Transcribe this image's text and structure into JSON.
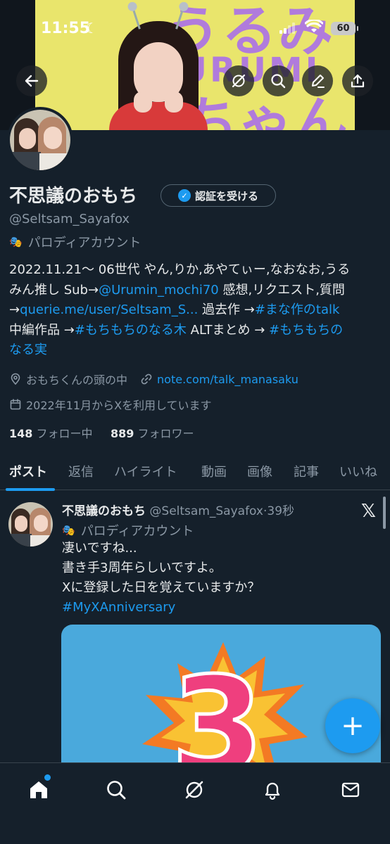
{
  "status_bar": {
    "time": "11:55",
    "battery": "60"
  },
  "banner": {
    "line1": "うるみ",
    "line2": "URUMI",
    "line3": "ちゃん"
  },
  "profile": {
    "display_name": "不思議のおもち",
    "verify_button": "認証を受ける",
    "handle": "@Seltsam_Sayafox",
    "parody_label": "パロディアカウント",
    "bio": {
      "l1": "2022.11.21～ 06世代 やん,りか,あやてぃー,なおなお,うる",
      "l2_a": "みん推し Sub→",
      "l2_link": "@Urumin_mochi70",
      "l2_b": " 感想,リクエスト,質問",
      "l3_a": "→",
      "l3_link": "querie.me/user/Seltsam_S...",
      "l3_b": " 過去作 →",
      "l3_link2": "#まな作のtalk",
      "l4_a": "中編作品 →",
      "l4_link": "#もちもちのなる木",
      "l4_b": " ALTまとめ → ",
      "l4_link2": "#もちもちの",
      "l5_link": "なる実"
    },
    "location": "おもちくんの頭の中",
    "website": "note.com/talk_manasaku",
    "joined": "2022年11月からXを利用しています",
    "following_count": "148",
    "following_label": "フォロー中",
    "followers_count": "889",
    "followers_label": "フォロワー"
  },
  "tabs": [
    {
      "label": "ポスト",
      "active": true
    },
    {
      "label": "返信"
    },
    {
      "label": "ハイライト"
    },
    {
      "label": "動画"
    },
    {
      "label": "画像"
    },
    {
      "label": "記事"
    },
    {
      "label": "いいね"
    }
  ],
  "post": {
    "author_name": "不思議のおもち",
    "author_handle": "@Seltsam_Sayafox",
    "separator": "·",
    "time": "39秒",
    "parody_label": "パロディアカウント",
    "lines": [
      "凄いですね...",
      "書き手3周年らしいですよ。",
      "Xに登録した日を覚えていますか？"
    ],
    "hashtag": "#MyXAnniversary",
    "media_number": "3"
  },
  "fab": {
    "label": "+"
  },
  "colors": {
    "background": "#15202b",
    "accent": "#1d9bf0",
    "secondary_text": "#8b98a5",
    "primary_text": "#e7e9ea"
  },
  "icons": {
    "back": "arrow-left-icon",
    "grok": "grok-icon",
    "search": "search-icon",
    "edit": "pencil-icon",
    "share": "share-icon",
    "home": "home-icon",
    "notifications": "bell-icon",
    "messages": "mail-icon"
  }
}
